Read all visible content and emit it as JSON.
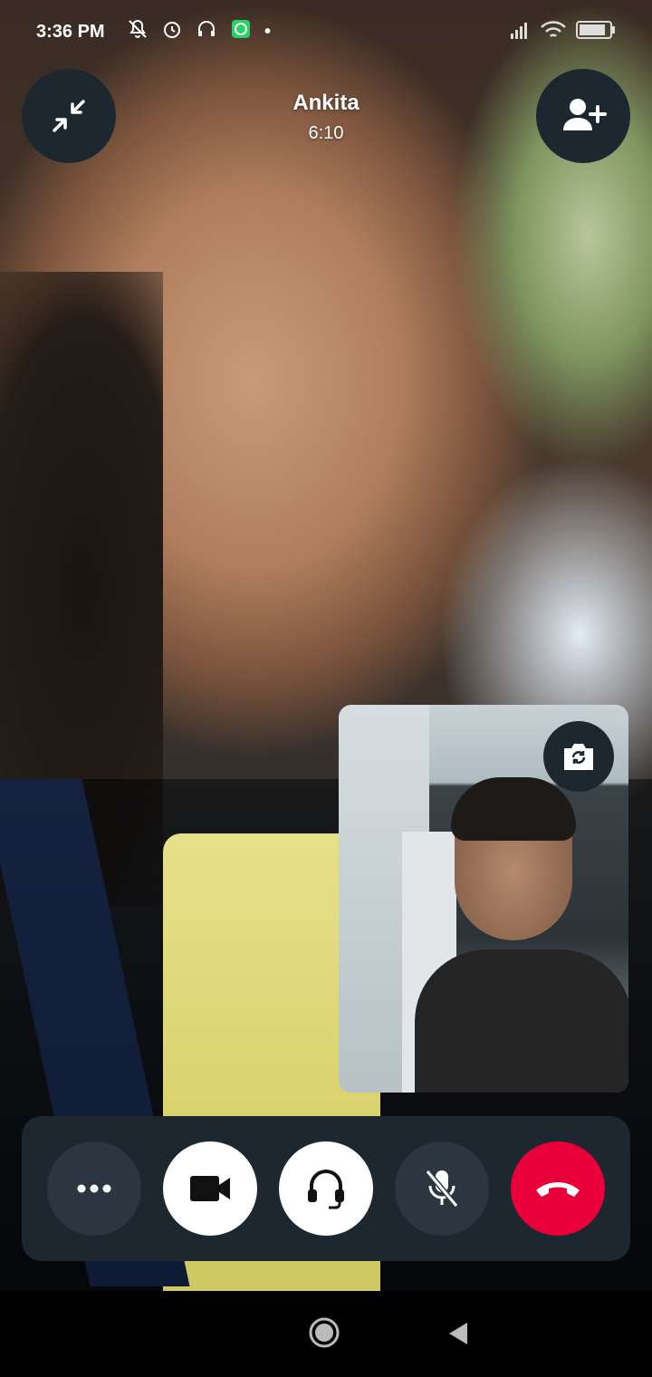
{
  "status_bar": {
    "time": "3:36 PM",
    "icons": [
      "mute-bell-icon",
      "alarm-icon",
      "headset-icon",
      "whatsapp-icon"
    ],
    "right_icons": [
      "signal-icon",
      "wifi-icon",
      "battery-icon"
    ]
  },
  "call": {
    "caller_name": "Ankita",
    "duration": "6:10"
  },
  "header": {
    "minimize_icon": "minimize-icon",
    "add_participant_icon": "add-person-icon"
  },
  "self_view": {
    "switch_camera_icon": "switch-camera-icon"
  },
  "controls": [
    {
      "name": "more-options",
      "icon": "more-icon"
    },
    {
      "name": "video",
      "icon": "video-camera-icon"
    },
    {
      "name": "audio-route",
      "icon": "headset-icon"
    },
    {
      "name": "mute",
      "icon": "mic-off-icon"
    },
    {
      "name": "end-call",
      "icon": "phone-hangup-icon"
    }
  ],
  "colors": {
    "end_call": "#ea0038",
    "control_bg": "#1d2730",
    "active_btn": "#ffffff"
  }
}
